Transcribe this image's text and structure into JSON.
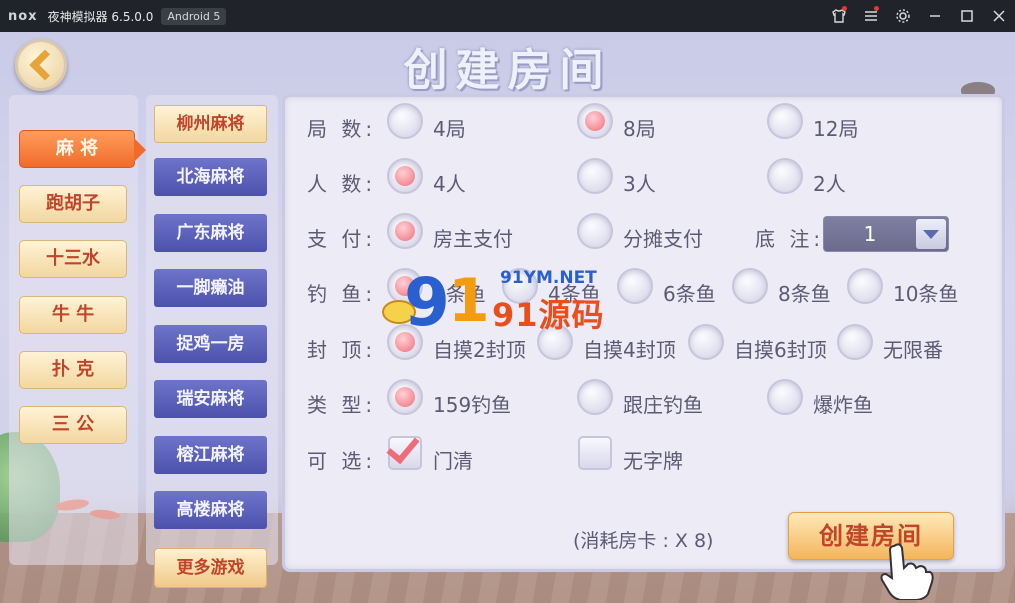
{
  "titlebar": {
    "logo": "nox",
    "title": "夜神模拟器 6.5.0.0",
    "android": "Android 5",
    "icons": [
      "shirt-icon",
      "menu-icon",
      "gear-icon",
      "minimize-icon",
      "maximize-icon",
      "close-icon"
    ]
  },
  "page": {
    "title": "创建房间"
  },
  "categories": [
    {
      "label": "麻 将",
      "active": true
    },
    {
      "label": "跑胡子",
      "active": false
    },
    {
      "label": "十三水",
      "active": false
    },
    {
      "label": "牛 牛",
      "active": false
    },
    {
      "label": "扑 克",
      "active": false
    },
    {
      "label": "三 公",
      "active": false
    }
  ],
  "games": [
    {
      "label": "柳州麻将",
      "active": true
    },
    {
      "label": "北海麻将",
      "active": false
    },
    {
      "label": "广东麻将",
      "active": false
    },
    {
      "label": "一脚癞油",
      "active": false
    },
    {
      "label": "捉鸡一房",
      "active": false
    },
    {
      "label": "瑞安麻将",
      "active": false
    },
    {
      "label": "榕江麻将",
      "active": false
    },
    {
      "label": "高楼麻将",
      "active": false
    }
  ],
  "more_games": "更多游戏",
  "settings": {
    "rounds": {
      "label": "局 数:",
      "options": [
        "4局",
        "8局",
        "12局"
      ],
      "selected": 1
    },
    "players": {
      "label": "人 数:",
      "options": [
        "4人",
        "3人",
        "2人"
      ],
      "selected": 0
    },
    "payment": {
      "label": "支 付:",
      "options": [
        "房主支付",
        "分摊支付"
      ],
      "selected": 0
    },
    "base_bet": {
      "label": "底 注:",
      "value": "1"
    },
    "fishing": {
      "label": "钓 鱼:",
      "options": [
        "2条鱼",
        "4条鱼",
        "6条鱼",
        "8条鱼",
        "10条鱼"
      ],
      "selected": 0
    },
    "cap": {
      "label": "封 顶:",
      "options": [
        "自摸2封顶",
        "自摸4封顶",
        "自摸6封顶",
        "无限番"
      ],
      "selected": 0
    },
    "type": {
      "label": "类 型:",
      "options": [
        "159钓鱼",
        "跟庄钓鱼",
        "爆炸鱼"
      ],
      "selected": 0
    },
    "optional": {
      "label": "可 选:",
      "options": [
        "门清",
        "无字牌"
      ],
      "checked": [
        true,
        false
      ]
    }
  },
  "cost": "(消耗房卡 : X 8)",
  "create_button": "创建房间",
  "watermark": {
    "url": "91YM.NET",
    "text": "91源码",
    "nine": "9",
    "one": "1"
  },
  "colors": {
    "accent_orange": "#f06b2a",
    "radio_selected": "#f06d7b",
    "panel_bg": "#ecebf6",
    "sub_button": "#5a60b8"
  }
}
